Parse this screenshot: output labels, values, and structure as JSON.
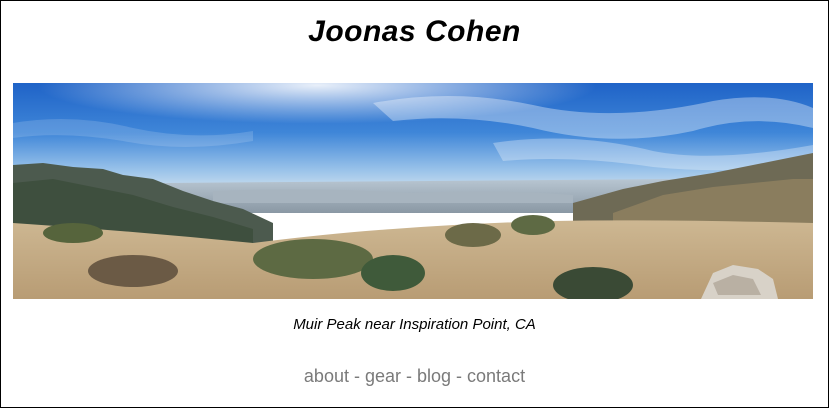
{
  "site": {
    "title": "Joonas Cohen"
  },
  "hero": {
    "caption": "Muir Peak near Inspiration Point, CA"
  },
  "nav": {
    "items": [
      {
        "label": "about"
      },
      {
        "label": "gear"
      },
      {
        "label": "blog"
      },
      {
        "label": "contact"
      }
    ],
    "separator": " - "
  },
  "colors": {
    "link": "#7a7a7a",
    "border": "#000000"
  }
}
